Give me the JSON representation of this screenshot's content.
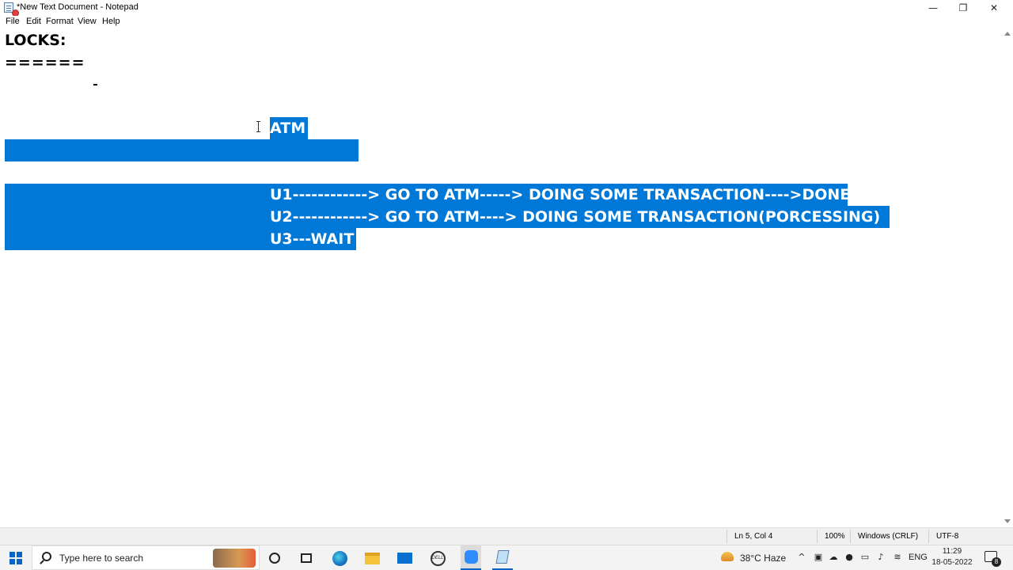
{
  "window": {
    "title": "*New Text Document - Notepad",
    "controls": {
      "minimize": "—",
      "maximize": "❐",
      "close": "✕"
    }
  },
  "menu": [
    "File",
    "Edit",
    "Format",
    "View",
    "Help"
  ],
  "document": {
    "lines": [
      "LOCKS:",
      "======",
      "-",
      "ATM",
      "U1------------> GO TO ATM-----> DOING SOME TRANSACTION---->DONE",
      "U2------------> GO TO ATM----> DOING SOME TRANSACTION(PORCESSING)",
      "U3---WAIT"
    ],
    "selection_color": "#0078d7"
  },
  "status": {
    "position": "Ln 5, Col 4",
    "zoom": "100%",
    "line_ending": "Windows (CRLF)",
    "encoding": "UTF-8"
  },
  "taskbar": {
    "search_placeholder": "Type here to search",
    "apps": [
      "search-icon",
      "cortana-icon",
      "task-view-icon",
      "edge-icon",
      "file-explorer-icon",
      "mail-icon",
      "dell-icon",
      "zoom-icon",
      "notepad-icon"
    ],
    "weather": "38°C Haze",
    "language": "ENG",
    "time": "11:29",
    "date": "18-05-2022",
    "notification_count": "8"
  }
}
